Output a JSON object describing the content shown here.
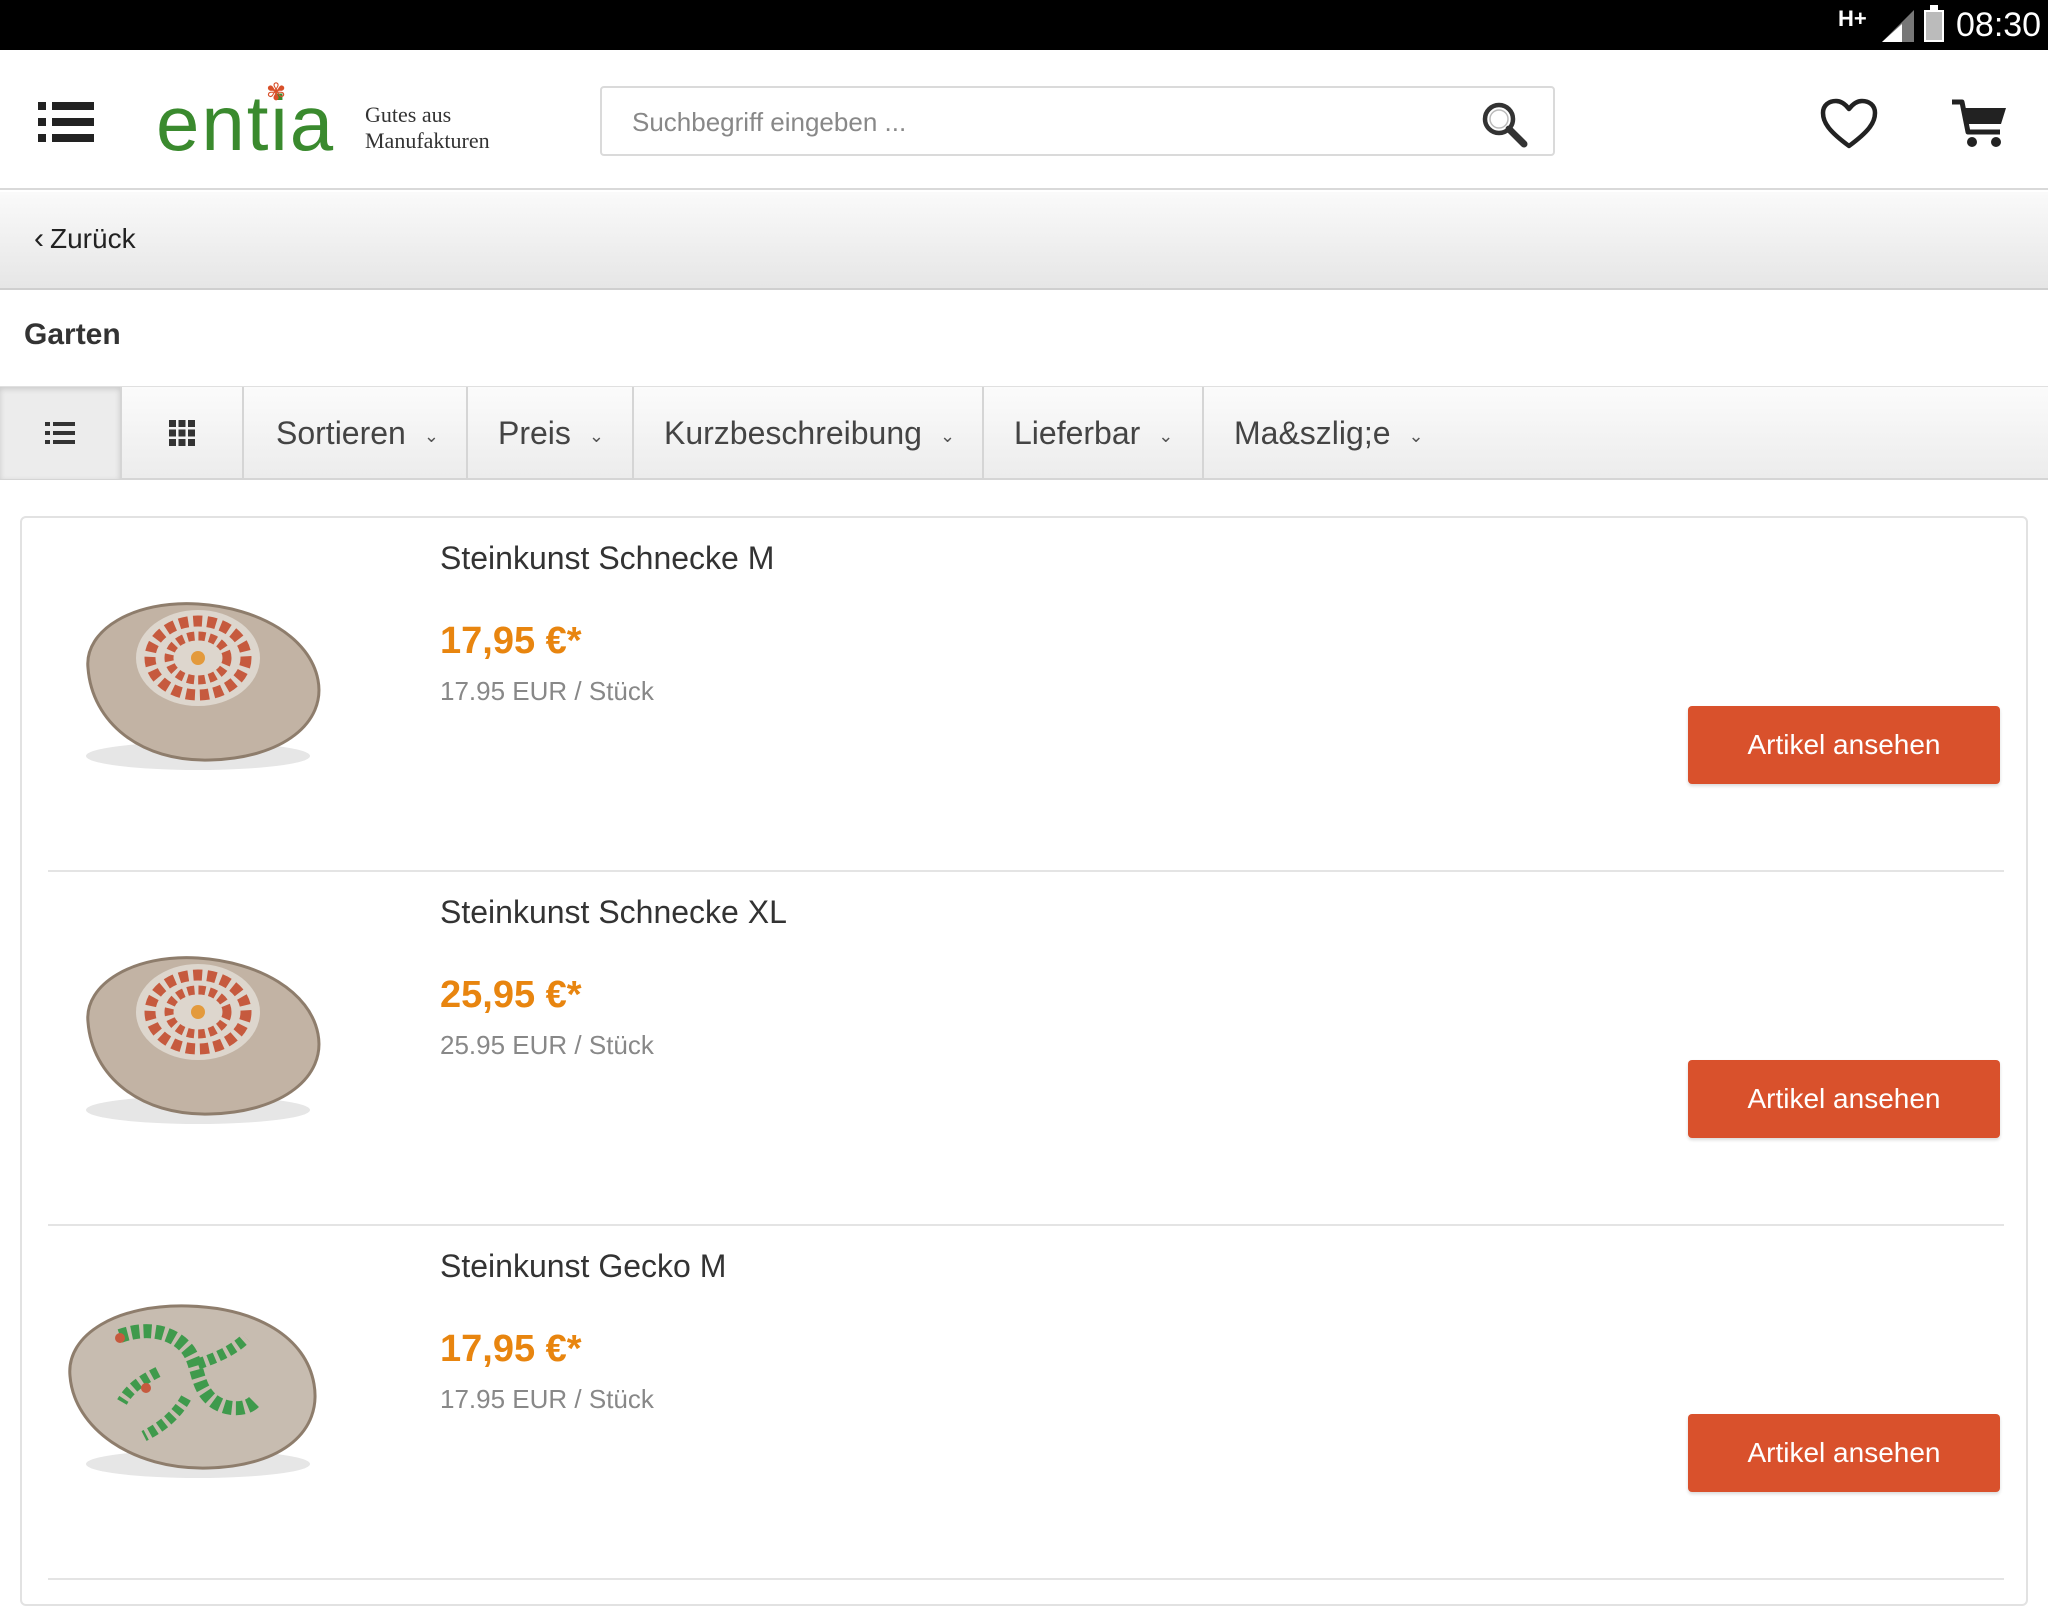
{
  "status_bar": {
    "network": "H+",
    "time": "08:30"
  },
  "header": {
    "logo_text": "entia",
    "logo_tagline_1": "Gutes aus",
    "logo_tagline_2": "Manufakturen",
    "search_placeholder": "Suchbegriff eingeben ..."
  },
  "nav": {
    "back_label": "Zurück"
  },
  "category_title": "Garten",
  "toolbar": {
    "filters": [
      "Sortieren",
      "Preis",
      "Kurzbeschreibung",
      "Lieferbar",
      "Ma&szlig;e"
    ]
  },
  "products": [
    {
      "title": "Steinkunst Schnecke M",
      "price": "17,95 €*",
      "unit_price": "17.95 EUR / Stück",
      "button": "Artikel ansehen",
      "motif": "snail"
    },
    {
      "title": "Steinkunst Schnecke XL",
      "price": "25,95 €*",
      "unit_price": "25.95 EUR / Stück",
      "button": "Artikel ansehen",
      "motif": "snail"
    },
    {
      "title": "Steinkunst Gecko M",
      "price": "17,95 €*",
      "unit_price": "17.95 EUR / Stück",
      "button": "Artikel ansehen",
      "motif": "gecko"
    }
  ],
  "colors": {
    "accent_button": "#d9512c",
    "price": "#e8850f",
    "logo_green": "#3a8a2e"
  }
}
